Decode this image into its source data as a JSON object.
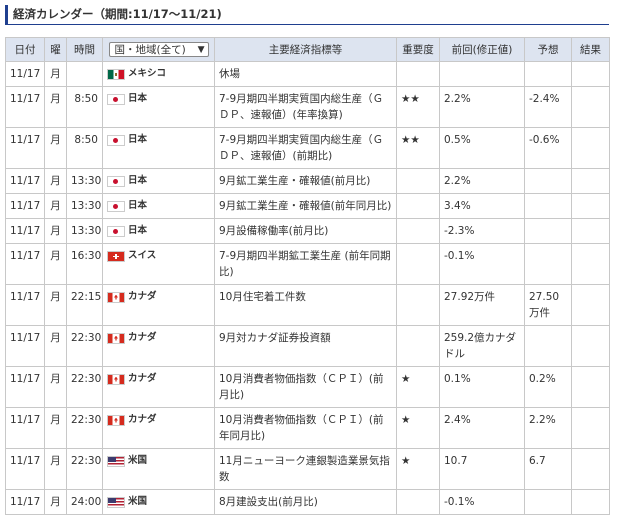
{
  "title": "経済カレンダー（期間:11/17～11/21)",
  "headers": {
    "date": "日付",
    "weekday": "曜",
    "time": "時間",
    "country_select": "国・地域(全て)",
    "indicator": "主要経済指標等",
    "importance": "重要度",
    "previous": "前回(修正値)",
    "forecast": "予想",
    "result": "結果"
  },
  "rows": [
    {
      "date": "11/17",
      "weekday": "月",
      "time": "",
      "flag": "mx",
      "country": "メキシコ",
      "indicator": "休場",
      "importance": "",
      "previous": "",
      "forecast": "",
      "result": ""
    },
    {
      "date": "11/17",
      "weekday": "月",
      "time": "8:50",
      "flag": "jp",
      "country": "日本",
      "indicator": "7-9月期四半期実質国内総生産（ＧＤＰ、速報値）(年率換算)",
      "importance": "★★",
      "previous": "2.2%",
      "forecast": "-2.4%",
      "result": ""
    },
    {
      "date": "11/17",
      "weekday": "月",
      "time": "8:50",
      "flag": "jp",
      "country": "日本",
      "indicator": "7-9月期四半期実質国内総生産（ＧＤＰ、速報値）(前期比)",
      "importance": "★★",
      "previous": "0.5%",
      "forecast": "-0.6%",
      "result": ""
    },
    {
      "date": "11/17",
      "weekday": "月",
      "time": "13:30",
      "flag": "jp",
      "country": "日本",
      "indicator": "9月鉱工業生産・確報値(前月比)",
      "importance": "",
      "previous": "2.2%",
      "forecast": "",
      "result": ""
    },
    {
      "date": "11/17",
      "weekday": "月",
      "time": "13:30",
      "flag": "jp",
      "country": "日本",
      "indicator": "9月鉱工業生産・確報値(前年同月比)",
      "importance": "",
      "previous": "3.4%",
      "forecast": "",
      "result": ""
    },
    {
      "date": "11/17",
      "weekday": "月",
      "time": "13:30",
      "flag": "jp",
      "country": "日本",
      "indicator": "9月設備稼働率(前月比)",
      "importance": "",
      "previous": "-2.3%",
      "forecast": "",
      "result": ""
    },
    {
      "date": "11/17",
      "weekday": "月",
      "time": "16:30",
      "flag": "ch",
      "country": "スイス",
      "indicator": "7-9月期四半期鉱工業生産 (前年同期比)",
      "importance": "",
      "previous": "-0.1%",
      "forecast": "",
      "result": ""
    },
    {
      "date": "11/17",
      "weekday": "月",
      "time": "22:15",
      "flag": "ca",
      "country": "カナダ",
      "indicator": "10月住宅着工件数",
      "importance": "",
      "previous": "27.92万件",
      "forecast": "27.50万件",
      "result": ""
    },
    {
      "date": "11/17",
      "weekday": "月",
      "time": "22:30",
      "flag": "ca",
      "country": "カナダ",
      "indicator": "9月対カナダ証券投資額",
      "importance": "",
      "previous": "259.2億カナダドル",
      "forecast": "",
      "result": ""
    },
    {
      "date": "11/17",
      "weekday": "月",
      "time": "22:30",
      "flag": "ca",
      "country": "カナダ",
      "indicator": "10月消費者物価指数（ＣＰＩ）(前月比)",
      "importance": "★",
      "previous": "0.1%",
      "forecast": "0.2%",
      "result": ""
    },
    {
      "date": "11/17",
      "weekday": "月",
      "time": "22:30",
      "flag": "ca",
      "country": "カナダ",
      "indicator": "10月消費者物価指数（ＣＰＩ）(前年同月比)",
      "importance": "★",
      "previous": "2.4%",
      "forecast": "2.2%",
      "result": ""
    },
    {
      "date": "11/17",
      "weekday": "月",
      "time": "22:30",
      "flag": "us",
      "country": "米国",
      "indicator": "11月ニューヨーク連銀製造業景気指数",
      "importance": "★",
      "previous": "10.7",
      "forecast": "6.7",
      "result": ""
    },
    {
      "date": "11/17",
      "weekday": "月",
      "time": "24:00",
      "flag": "us",
      "country": "米国",
      "indicator": "8月建設支出(前月比)",
      "importance": "",
      "previous": "-0.1%",
      "forecast": "",
      "result": ""
    }
  ]
}
